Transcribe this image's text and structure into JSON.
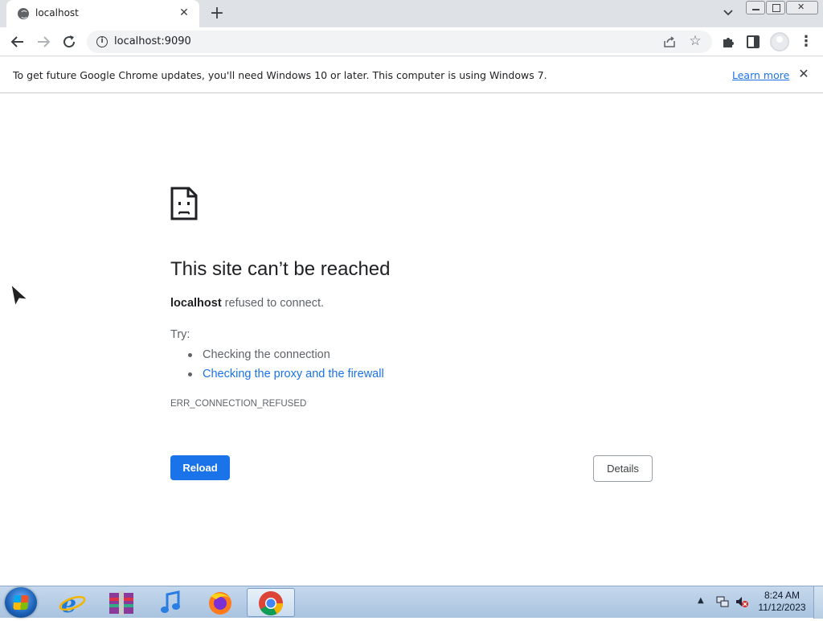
{
  "browser": {
    "tab": {
      "title": "localhost",
      "close_icon": "close-icon"
    },
    "new_tab_label": "+",
    "address": {
      "url": "localhost:9090"
    },
    "infobar": {
      "message": "To get future Google Chrome updates, you'll need Windows 10 or later. This computer is using Windows 7.",
      "link": "Learn more"
    }
  },
  "error_page": {
    "title": "This site can’t be reached",
    "host": "localhost",
    "desc_suffix": " refused to connect.",
    "try_label": "Try:",
    "suggestions": [
      "Checking the connection",
      "Checking the proxy and the firewall"
    ],
    "error_code": "ERR_CONNECTION_REFUSED",
    "reload_label": "Reload",
    "details_label": "Details"
  },
  "taskbar": {
    "pinned": [
      "ie-icon",
      "archive-icon",
      "itunes-icon",
      "firefox-icon",
      "chrome-icon"
    ],
    "clock": {
      "time": "8:24 AM",
      "date": "11/12/2023"
    }
  },
  "colors": {
    "accent": "#1a73e8",
    "text_primary": "#202124",
    "text_secondary": "#5f6368"
  }
}
